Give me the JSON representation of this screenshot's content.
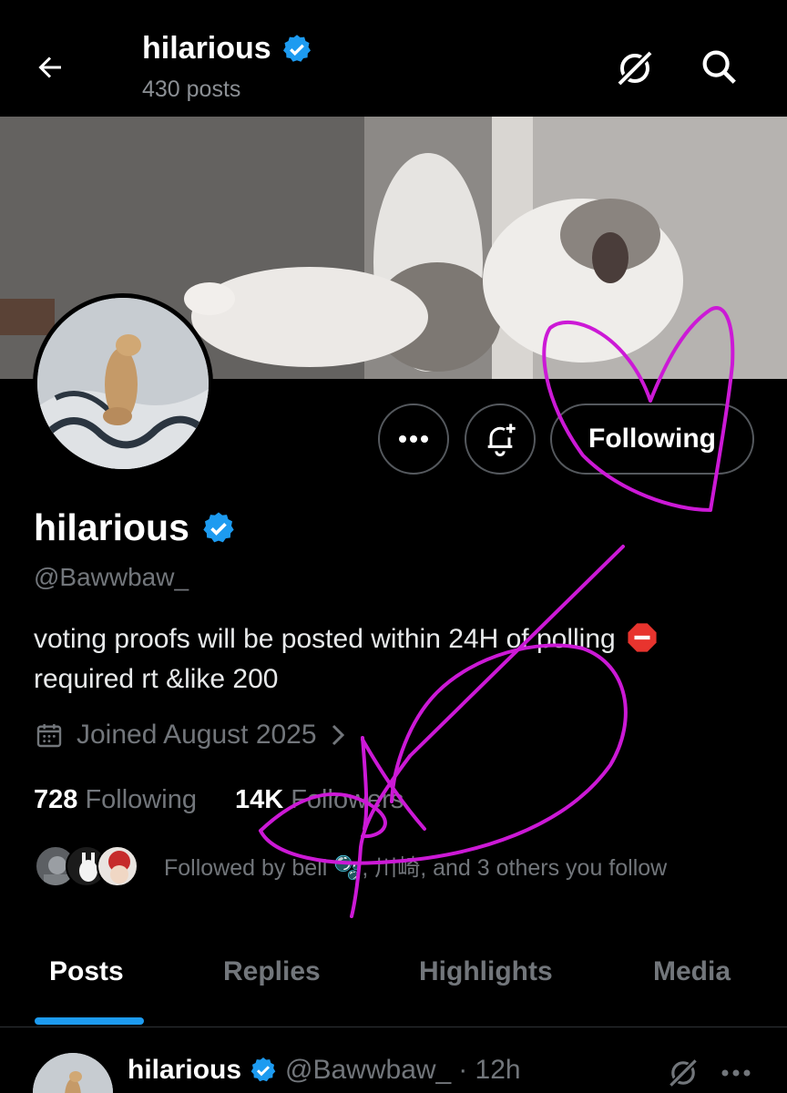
{
  "header": {
    "back_icon": "arrow-left-icon",
    "title": "hilarious",
    "posts_count": "430 posts",
    "grok_icon": "grok-icon",
    "search_icon": "search-icon"
  },
  "profile": {
    "name": "hilarious",
    "handle": "@Bawwbaw_",
    "bio_line1": "voting proofs will be posted within 24H of polling",
    "bio_line2": "required rt &like 200",
    "joined": "Joined August 2025",
    "following_count": "728",
    "following_label": "Following",
    "followers_count": "14K",
    "followers_label": "Followers",
    "followed_by": "Followed by bell 🫧, 川崎, and 3 others you follow"
  },
  "actions": {
    "more_icon": "more-icon",
    "notify_icon": "bell-plus-icon",
    "following_button": "Following"
  },
  "tabs": [
    {
      "label": "Posts",
      "active": true
    },
    {
      "label": "Replies",
      "active": false
    },
    {
      "label": "Highlights",
      "active": false
    },
    {
      "label": "Media",
      "active": false
    }
  ],
  "post": {
    "name": "hilarious",
    "handle": "@Bawwbaw_",
    "time": "· 12h"
  },
  "colors": {
    "accent": "#1d9bf0",
    "verified": "#1d9bf0",
    "annotation": "#cc19d6",
    "muted": "#72767b"
  }
}
